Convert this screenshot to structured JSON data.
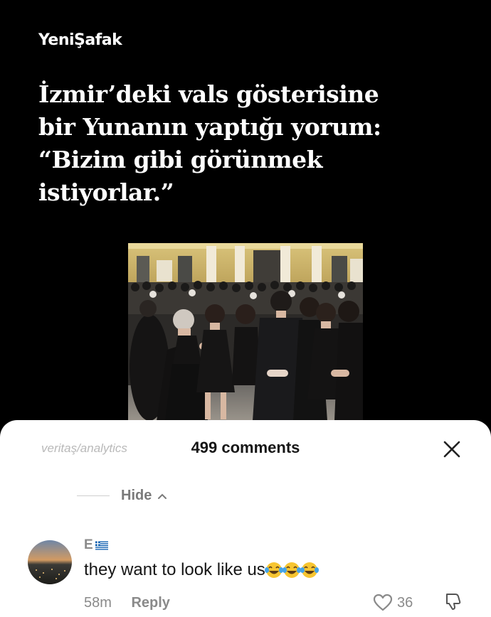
{
  "post": {
    "brand": "YeniŞafak",
    "headline_lines": [
      "İzmir’deki vals gösterisine",
      "bir Yunanın yaptığı yorum:",
      "“Bizim gibi görünmek",
      "istiyorlar.”"
    ]
  },
  "comments_sheet": {
    "watermark": "veritaş/analytics",
    "title": "499 comments",
    "hide_label": "Hide",
    "comment": {
      "username": "E",
      "text": "they want to look like us",
      "emoji_count": 3,
      "time": "58m",
      "reply_label": "Reply",
      "likes": "36"
    }
  },
  "icons": [
    "close-icon",
    "chevron-up-icon",
    "greek-flag-icon",
    "tears-of-joy-emoji",
    "heart-icon",
    "thumbs-down-icon"
  ]
}
